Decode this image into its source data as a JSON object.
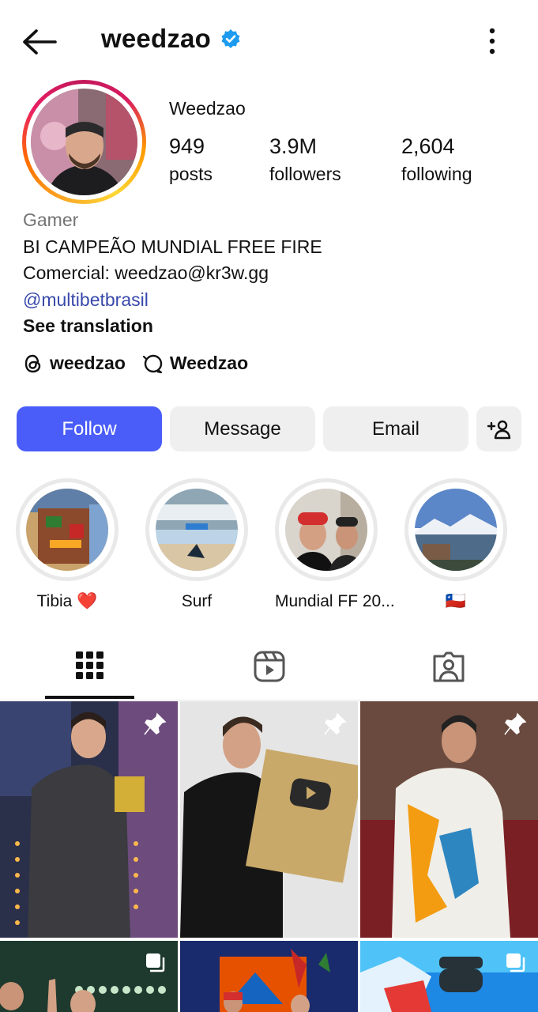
{
  "header": {
    "username": "weedzao",
    "verified_icon": "verified-badge-icon",
    "back_icon": "arrow-left-icon",
    "more_icon": "more-vertical-icon"
  },
  "profile": {
    "display_name": "Weedzao",
    "stats": [
      {
        "value": "949",
        "label": "posts"
      },
      {
        "value": "3.9M",
        "label": "followers"
      },
      {
        "value": "2,604",
        "label": "following"
      }
    ],
    "bio": {
      "category": "Gamer",
      "line1": "BI CAMPEÃO MUNDIAL FREE FIRE",
      "line2": "Comercial: weedzao@kr3w.gg",
      "link": "@multibetbrasil",
      "see_translation": "See translation"
    },
    "threads": {
      "threads_handle": "weedzao",
      "messenger_name": "Weedzao"
    }
  },
  "actions": {
    "follow": "Follow",
    "message": "Message",
    "email": "Email",
    "add_user_icon": "add-person-icon"
  },
  "highlights": [
    {
      "label": "Tibia ❤️"
    },
    {
      "label": "Surf"
    },
    {
      "label": "Mundial FF 20..."
    },
    {
      "label": "🇨🇱"
    }
  ],
  "tabs": [
    {
      "icon": "grid-icon",
      "active": true
    },
    {
      "icon": "reels-icon",
      "active": false
    },
    {
      "icon": "tagged-icon",
      "active": false
    }
  ],
  "colors": {
    "follow_button": "#4a5df9",
    "link": "#3949ab",
    "verified": "#1d9bf0",
    "secondary_text": "#737373"
  }
}
